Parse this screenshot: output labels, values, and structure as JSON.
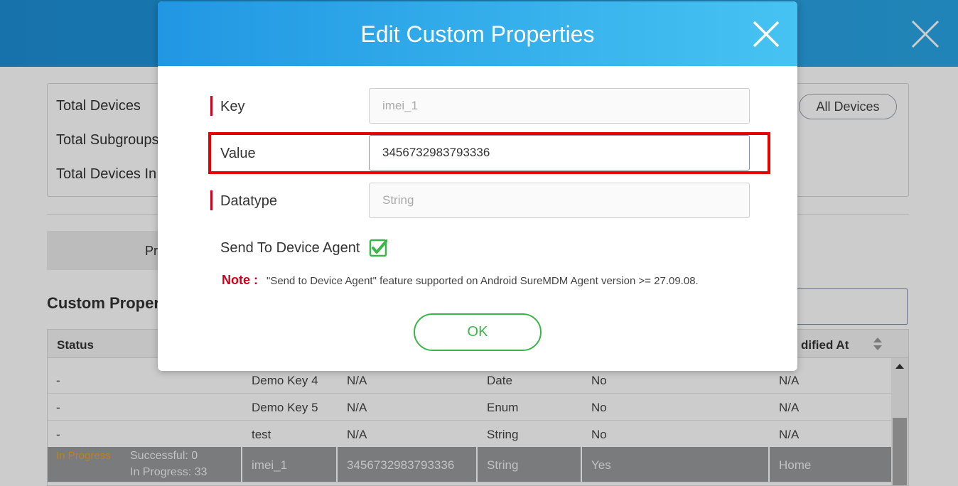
{
  "background": {
    "summary": {
      "labels": [
        "Total Devices",
        "Total Subgroups",
        "Total Devices In G"
      ],
      "all_devices_button": "All Devices"
    },
    "tab_label": "Pr",
    "section_title": "Custom Proper",
    "table": {
      "headers": {
        "status": "Status",
        "modified_at": "dified At"
      },
      "rows": [
        {
          "status": "-",
          "key": "Demo Key 4",
          "value": "N/A",
          "datatype": "Date",
          "send": "No",
          "modified": "N/A"
        },
        {
          "status": "-",
          "key": "Demo Key 5",
          "value": "N/A",
          "datatype": "Enum",
          "send": "No",
          "modified": "N/A"
        },
        {
          "status": "-",
          "key": "test",
          "value": "N/A",
          "datatype": "String",
          "send": "No",
          "modified": "N/A"
        }
      ],
      "selected_row": {
        "status": "In Progress",
        "successful": "Successful: 0",
        "in_progress": "In Progress: 33",
        "key": "imei_1",
        "value": "3456732983793336",
        "datatype": "String",
        "send": "Yes",
        "modified": "Home"
      }
    }
  },
  "modal": {
    "title": "Edit Custom Properties",
    "key_label": "Key",
    "key_placeholder": "imei_1",
    "value_label": "Value",
    "value_text": "3456732983793336",
    "datatype_label": "Datatype",
    "datatype_placeholder": "String",
    "send_label": "Send To Device Agent",
    "send_checked": true,
    "note_label": "Note :",
    "note_text": "\"Send to Device Agent\" feature supported on Android SureMDM Agent version >= 27.09.08.",
    "ok_label": "OK"
  },
  "colors": {
    "header_blue": "#2197e3",
    "required_red": "#d0021b",
    "ok_green": "#3bb54a",
    "highlight_red": "#e60000",
    "in_progress_orange": "#f0a020"
  },
  "icons": [
    "close-icon",
    "checkbox-checked-icon",
    "sort-icon",
    "scroll-up-icon"
  ]
}
